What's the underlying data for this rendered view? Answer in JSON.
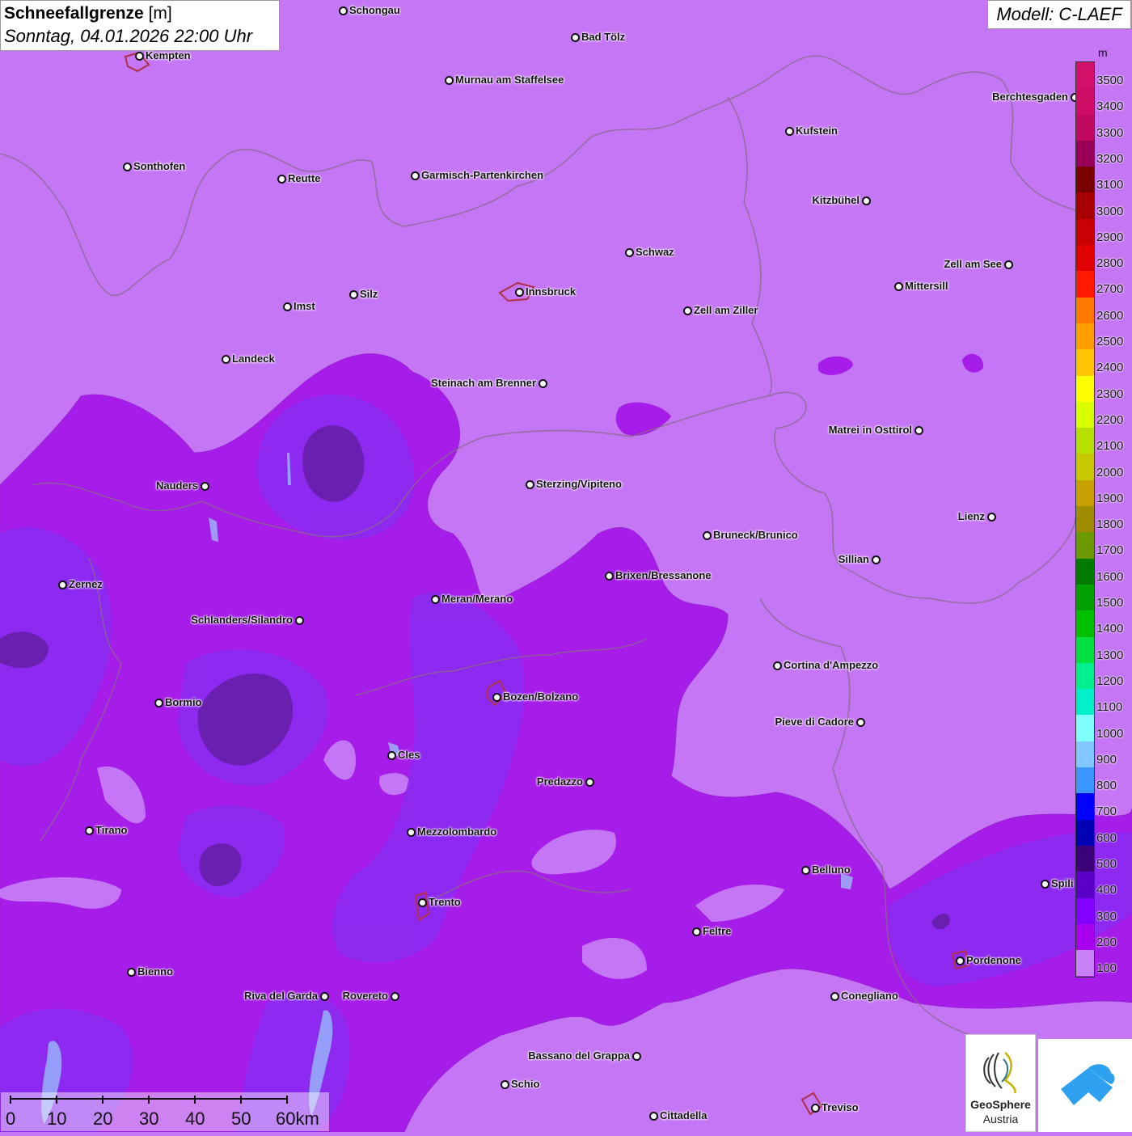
{
  "header": {
    "parameter": "Schneefallgrenze",
    "unit": "[m]",
    "datetime": "Sonntag, 04.01.2026 22:00 Uhr",
    "model": "Modell: C-LAEF"
  },
  "legend": {
    "unit": "m",
    "levels": [
      {
        "value": "3500",
        "color": "#d4106a"
      },
      {
        "value": "3400",
        "color": "#cf0d67"
      },
      {
        "value": "3300",
        "color": "#c0095f"
      },
      {
        "value": "3200",
        "color": "#9b0058"
      },
      {
        "value": "3100",
        "color": "#7a0000"
      },
      {
        "value": "3000",
        "color": "#a80000"
      },
      {
        "value": "2900",
        "color": "#c80000"
      },
      {
        "value": "2800",
        "color": "#e00000"
      },
      {
        "value": "2700",
        "color": "#ff1a00"
      },
      {
        "value": "2600",
        "color": "#ff7a00"
      },
      {
        "value": "2500",
        "color": "#ffa000"
      },
      {
        "value": "2400",
        "color": "#ffc400"
      },
      {
        "value": "2300",
        "color": "#ffff00"
      },
      {
        "value": "2200",
        "color": "#d8ff00"
      },
      {
        "value": "2100",
        "color": "#b8e000"
      },
      {
        "value": "2000",
        "color": "#c8c800"
      },
      {
        "value": "1900",
        "color": "#c8a000"
      },
      {
        "value": "1800",
        "color": "#a08c00"
      },
      {
        "value": "1700",
        "color": "#6a9a00"
      },
      {
        "value": "1600",
        "color": "#007a00"
      },
      {
        "value": "1500",
        "color": "#00a000"
      },
      {
        "value": "1400",
        "color": "#00c000"
      },
      {
        "value": "1300",
        "color": "#00e040"
      },
      {
        "value": "1200",
        "color": "#00f090"
      },
      {
        "value": "1100",
        "color": "#00f0c8"
      },
      {
        "value": "1000",
        "color": "#80ffff"
      },
      {
        "value": "900",
        "color": "#80c8ff"
      },
      {
        "value": "800",
        "color": "#3c96ff"
      },
      {
        "value": "700",
        "color": "#0000ff"
      },
      {
        "value": "600",
        "color": "#0000b4"
      },
      {
        "value": "500",
        "color": "#3c0078"
      },
      {
        "value": "400",
        "color": "#5a00c8"
      },
      {
        "value": "300",
        "color": "#8200ff"
      },
      {
        "value": "200",
        "color": "#aa00f0"
      },
      {
        "value": "100",
        "color": "#c880f8"
      }
    ]
  },
  "cities": [
    {
      "name": "Schongau"
    },
    {
      "name": "Bad Tölz"
    },
    {
      "name": "Kempten"
    },
    {
      "name": "Murnau am Staffelsee"
    },
    {
      "name": "Berchtesgaden"
    },
    {
      "name": "Kufstein"
    },
    {
      "name": "Sonthofen"
    },
    {
      "name": "Reutte"
    },
    {
      "name": "Garmisch-Partenkirchen"
    },
    {
      "name": "Kitzbühel"
    },
    {
      "name": "Schwaz"
    },
    {
      "name": "Zell am See"
    },
    {
      "name": "Mittersill"
    },
    {
      "name": "Innsbruck"
    },
    {
      "name": "Silz"
    },
    {
      "name": "Imst"
    },
    {
      "name": "Zell am Ziller"
    },
    {
      "name": "Landeck"
    },
    {
      "name": "Steinach am Brenner"
    },
    {
      "name": "Matrei in Osttirol"
    },
    {
      "name": "Nauders"
    },
    {
      "name": "Sterzing/Vipiteno"
    },
    {
      "name": "Lienz"
    },
    {
      "name": "Bruneck/Brunico"
    },
    {
      "name": "Sillian"
    },
    {
      "name": "Zernez"
    },
    {
      "name": "Brixen/Bressanone"
    },
    {
      "name": "Meran/Merano"
    },
    {
      "name": "Schlanders/Silandro"
    },
    {
      "name": "Cortina d'Ampezzo"
    },
    {
      "name": "Bozen/Bolzano"
    },
    {
      "name": "Bormio"
    },
    {
      "name": "Pieve di Cadore"
    },
    {
      "name": "Cles"
    },
    {
      "name": "Predazzo"
    },
    {
      "name": "Tirano"
    },
    {
      "name": "Mezzolombardo"
    },
    {
      "name": "Belluno"
    },
    {
      "name": "Spili"
    },
    {
      "name": "Trento"
    },
    {
      "name": "Feltre"
    },
    {
      "name": "Pordenone"
    },
    {
      "name": "Bienno"
    },
    {
      "name": "Riva del Garda"
    },
    {
      "name": "Rovereto"
    },
    {
      "name": "Conegliano"
    },
    {
      "name": "Bassano del Grappa"
    },
    {
      "name": "Schio"
    },
    {
      "name": "Treviso"
    },
    {
      "name": "Cittadella"
    }
  ],
  "scalebar": {
    "labels": [
      "0",
      "10",
      "20",
      "30",
      "40",
      "50",
      "60km"
    ]
  },
  "logos": {
    "geosphere_name": "GeoSphere",
    "geosphere_sub": "Austria"
  }
}
